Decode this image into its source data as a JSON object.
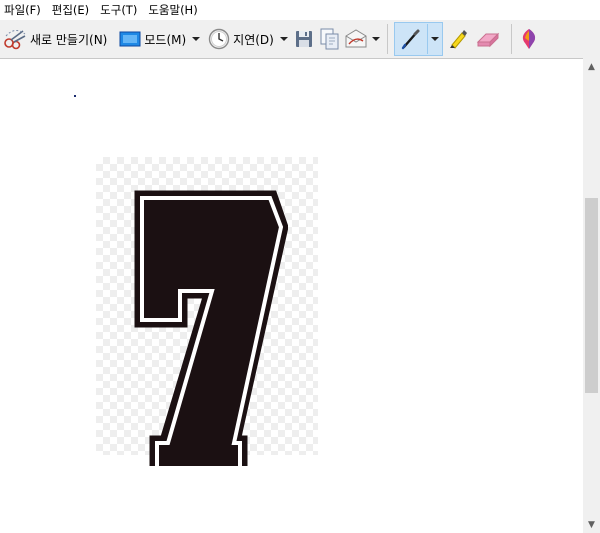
{
  "menu": {
    "items": [
      "파일(F)",
      "편집(E)",
      "도구(T)",
      "도움말(H)"
    ]
  },
  "toolbar": {
    "new_label": "새로 만들기(N)",
    "mode_label": "모드(M)",
    "delay_label": "지연(D)",
    "icons": [
      "new-snip-icon",
      "mode-icon",
      "clock-icon",
      "save-icon",
      "copy-icon",
      "send-email-icon",
      "pen-icon",
      "highlighter-icon",
      "eraser-icon",
      "paint3d-icon"
    ]
  },
  "canvas": {
    "snip_content": "7",
    "colors": {
      "digit_fill": "#1b1012",
      "checker": "#eeeeee",
      "pen_highlight": "#cde4f7"
    }
  }
}
